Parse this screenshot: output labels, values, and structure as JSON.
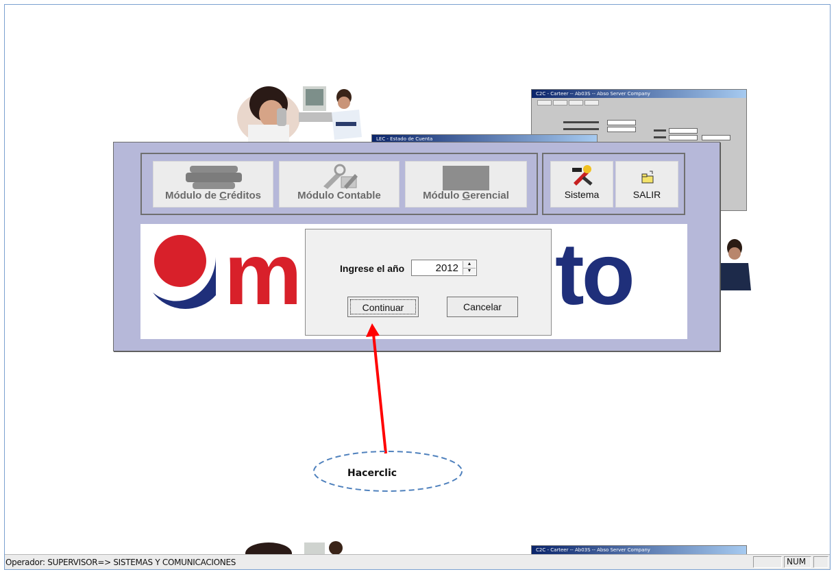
{
  "app_window": {
    "modules": [
      {
        "label_pre": "Módulo de ",
        "label_key": "C",
        "label_post": "réditos"
      },
      {
        "label_pre": "Módulo Contable",
        "label_key": "",
        "label_post": ""
      },
      {
        "label_pre": "Módulo ",
        "label_key": "G",
        "label_post": "erencial"
      }
    ],
    "system_buttons": [
      {
        "label": "Sistema",
        "icon": "tools-icon"
      },
      {
        "label": "SALIR",
        "icon": "folder-exit-icon"
      }
    ],
    "logo": {
      "left_letter": "m",
      "right_letters": "to",
      "colors": {
        "red": "#d8202a",
        "navy": "#1f2f7a"
      }
    }
  },
  "background_windows": {
    "top_window_title": "C2C - Carteer -- Ab03S -- Abso Server Company",
    "middle_window_title": "LEC - Estado de Cuenta",
    "bottom_window_title": "C2C - Carteer -- Ab03S -- Abso Server Company"
  },
  "dialog": {
    "label": "Ingrese el año",
    "year_value": "2012",
    "continue_label": "Continuar",
    "cancel_label": "Cancelar"
  },
  "annotation": {
    "text": "Hacerclic",
    "arrow_color": "#ff0000",
    "ellipse_color": "#4f81bd"
  },
  "statusbar": {
    "text": "Operador: SUPERVISOR=> SISTEMAS Y COMUNICACIONES",
    "num_indicator": "NUM"
  }
}
